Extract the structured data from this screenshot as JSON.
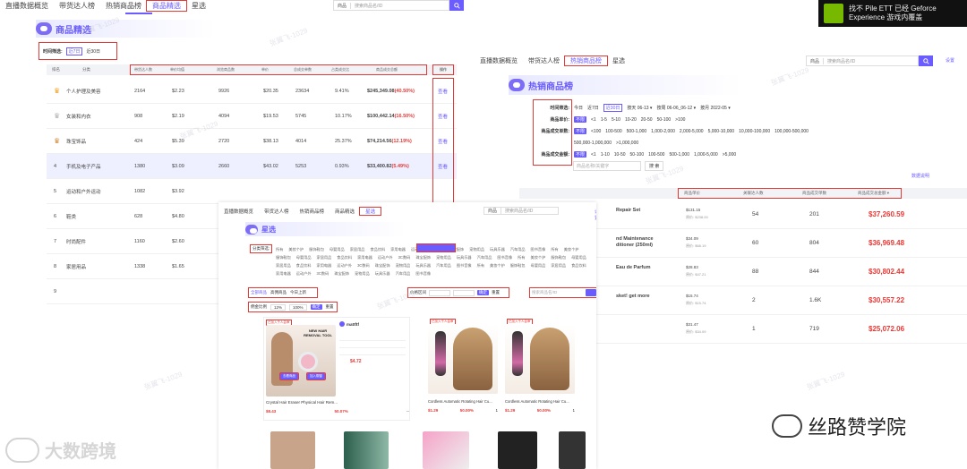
{
  "win1": {
    "nav": [
      "直播数据概览",
      "带货达人榜",
      "热销商品榜",
      "商品精选",
      "星选"
    ],
    "search": {
      "select": "商品",
      "placeholder": "搜索商品名/ID"
    },
    "settings": "设置",
    "title": "商品精选",
    "time_label": "时间筛选:",
    "time_opts": [
      "近7日",
      "近30日"
    ],
    "headers": [
      "排名",
      "分类",
      "带货达人数",
      "单价均值",
      "浏览商品数",
      "单价",
      "总成交单数",
      "占类成交比",
      "商品成交总额",
      "操作"
    ],
    "rows": [
      {
        "rank": "",
        "cat": "个人护理及美容",
        "a": "2164",
        "b": "$2.23",
        "c": "9926",
        "d": "$20.35",
        "e": "23634",
        "f": "9.41%",
        "total": "$245,349.08",
        "pct": "(40.50%)",
        "op": "查看"
      },
      {
        "rank": "",
        "cat": "女装和内衣",
        "a": "908",
        "b": "$2.19",
        "c": "4094",
        "d": "$19.53",
        "e": "5745",
        "f": "10.17%",
        "total": "$100,442.14",
        "pct": "(16.50%)",
        "op": "查看"
      },
      {
        "rank": "",
        "cat": "珠宝饰品",
        "a": "424",
        "b": "$5.39",
        "c": "2720",
        "d": "$38.13",
        "e": "4014",
        "f": "25.37%",
        "total": "$74,214.56",
        "pct": "(12.19%)",
        "op": "查看"
      },
      {
        "rank": "4",
        "cat": "手机及电子产品",
        "a": "1380",
        "b": "$3.09",
        "c": "2660",
        "d": "$43.02",
        "e": "5253",
        "f": "0.93%",
        "total": "$33,400.82",
        "pct": "(5.49%)",
        "op": "查看"
      },
      {
        "rank": "5",
        "cat": "运动和户外运动",
        "a": "1082",
        "b": "$3.92",
        "c": "",
        "d": "",
        "e": "",
        "f": "",
        "total": "",
        "pct": "",
        "op": ""
      },
      {
        "rank": "6",
        "cat": "鞋类",
        "a": "628",
        "b": "$4.80",
        "c": "",
        "d": "",
        "e": "",
        "f": "",
        "total": "",
        "pct": "",
        "op": ""
      },
      {
        "rank": "7",
        "cat": "时尚配件",
        "a": "1160",
        "b": "$2.60",
        "c": "",
        "d": "",
        "e": "",
        "f": "",
        "total": "",
        "pct": "",
        "op": ""
      },
      {
        "rank": "8",
        "cat": "家居用品",
        "a": "1338",
        "b": "$1.65",
        "c": "",
        "d": "",
        "e": "",
        "f": "",
        "total": "",
        "pct": "",
        "op": ""
      },
      {
        "rank": "9",
        "cat": "",
        "a": "",
        "b": "",
        "c": "",
        "d": "",
        "e": "",
        "f": "",
        "total": "",
        "pct": "",
        "op": ""
      }
    ]
  },
  "win2": {
    "nav": [
      "直播数据概览",
      "带货达人榜",
      "热销商品榜",
      "星选"
    ],
    "search": {
      "select": "商品",
      "placeholder": "搜索商品名/ID"
    },
    "settings": "设置",
    "title": "热销商品榜",
    "f_time": "时间筛选:",
    "time_opts": [
      "今日",
      "近7日",
      "近30日",
      "按天 06-13 ▾",
      "按周 06-06_06-12 ▾",
      "按月 2022-05 ▾"
    ],
    "f_price": "商品单价:",
    "price_opts": [
      "不限",
      "<1",
      "1-5",
      "5-10",
      "10-20",
      "20-50",
      "50-100",
      ">100"
    ],
    "f_orders": "商品成交单数:",
    "orders_opts": [
      "不限",
      "<100",
      "100-500",
      "500-1,000",
      "1,000-2,000",
      "2,000-5,000",
      "5,000-10,000",
      "10,000-100,000",
      "100,000-500,000"
    ],
    "orders_opts2": [
      "500,000-1,000,000",
      ">1,000,000"
    ],
    "f_gmv": "商品成交金额:",
    "gmv_opts": [
      "不限",
      "<1",
      "1-10",
      "10-50",
      "50-100",
      "100-500",
      "500-1,000",
      "1,000-5,000",
      ">5,000"
    ],
    "name_placeholder": "商品名称/关键字",
    "search_btn": "搜 索",
    "export": "数据说明",
    "headers": [
      "商品单价",
      "关联达人数",
      "商品成交单数",
      "商品成交总金额 ▾"
    ],
    "rows": [
      {
        "name": "Repair Set",
        "price": "$131.15",
        "price2": "原价: $238.00",
        "n": "54",
        "orders": "201",
        "gmv": "$37,260.59"
      },
      {
        "name": "nd Maintenance ditioner (250ml)",
        "price": "$34.09",
        "price2": "原价: $68.19",
        "n": "60",
        "orders": "804",
        "gmv": "$36,969.48"
      },
      {
        "name": "Eau de Parfum",
        "price": "$28.83",
        "price2": "原价: $47.21",
        "n": "88",
        "orders": "844",
        "gmv": "$30,802.44"
      },
      {
        "name": "sket!  get more",
        "price": "$15.74",
        "price2": "原价: $15.74",
        "n": "2",
        "orders": "1.6K",
        "gmv": "$30,557.22"
      },
      {
        "name": "",
        "price": "$31.47",
        "price2": "原价: $34.09",
        "n": "1",
        "orders": "719",
        "gmv": "$25,072.06"
      }
    ]
  },
  "win3": {
    "nav": [
      "直播数据概览",
      "带货达人榜",
      "热销商品榜",
      "商品精选",
      "星选"
    ],
    "search": {
      "select": "商品",
      "placeholder": "搜索商品名/ID"
    },
    "settings": "设置",
    "title": "星选",
    "cat_label": "分类筛选:",
    "cats1": [
      "所有",
      "美妆个护",
      "服饰鞋包",
      "母婴用品",
      "家居用品",
      "食品饮料",
      "家用电器",
      "运动户外",
      "3C数码",
      "珠宝配饰",
      "宠物用品",
      "玩具乐器",
      "汽车用品",
      "图书音像"
    ],
    "tabs": [
      "全部商品",
      "高佣商品",
      "今日上新"
    ],
    "range_label": "佣金比例",
    "range_a": "12%",
    "range_b": "100%",
    "confirm": "确定",
    "reset": "重置",
    "price_label": "价格区间",
    "kw_placeholder": "搜索商品名/ID",
    "shop": "mattftf",
    "price": "$4.72",
    "newhair": "NEW HAIR REMOVAL TOOL",
    "btn1": "去看商品",
    "btn2": "加入橱窗",
    "products": [
      {
        "name": "Crystal Hair Eraser Physical Hair Rem...",
        "p": "$8.43",
        "c": "50.07%",
        "s": "--"
      },
      {
        "name": "Cordless Automatic Rotating Hair Cu...",
        "p": "$1.29",
        "c": "50.00%",
        "s": "1"
      },
      {
        "name": "Cordless Automatic Rotating Hair Cu...",
        "p": "$1.29",
        "c": "50.00%",
        "s": "1"
      }
    ],
    "tag": "已加入千人会审"
  },
  "corner": {
    "line1": "找不 Pile ETT 已经 Geforce",
    "line2": "Experience 游戏内覆盖"
  },
  "watermark": "张翼飞-1029",
  "brand_left": "大数跨境",
  "brand_right": "丝路赞学院"
}
